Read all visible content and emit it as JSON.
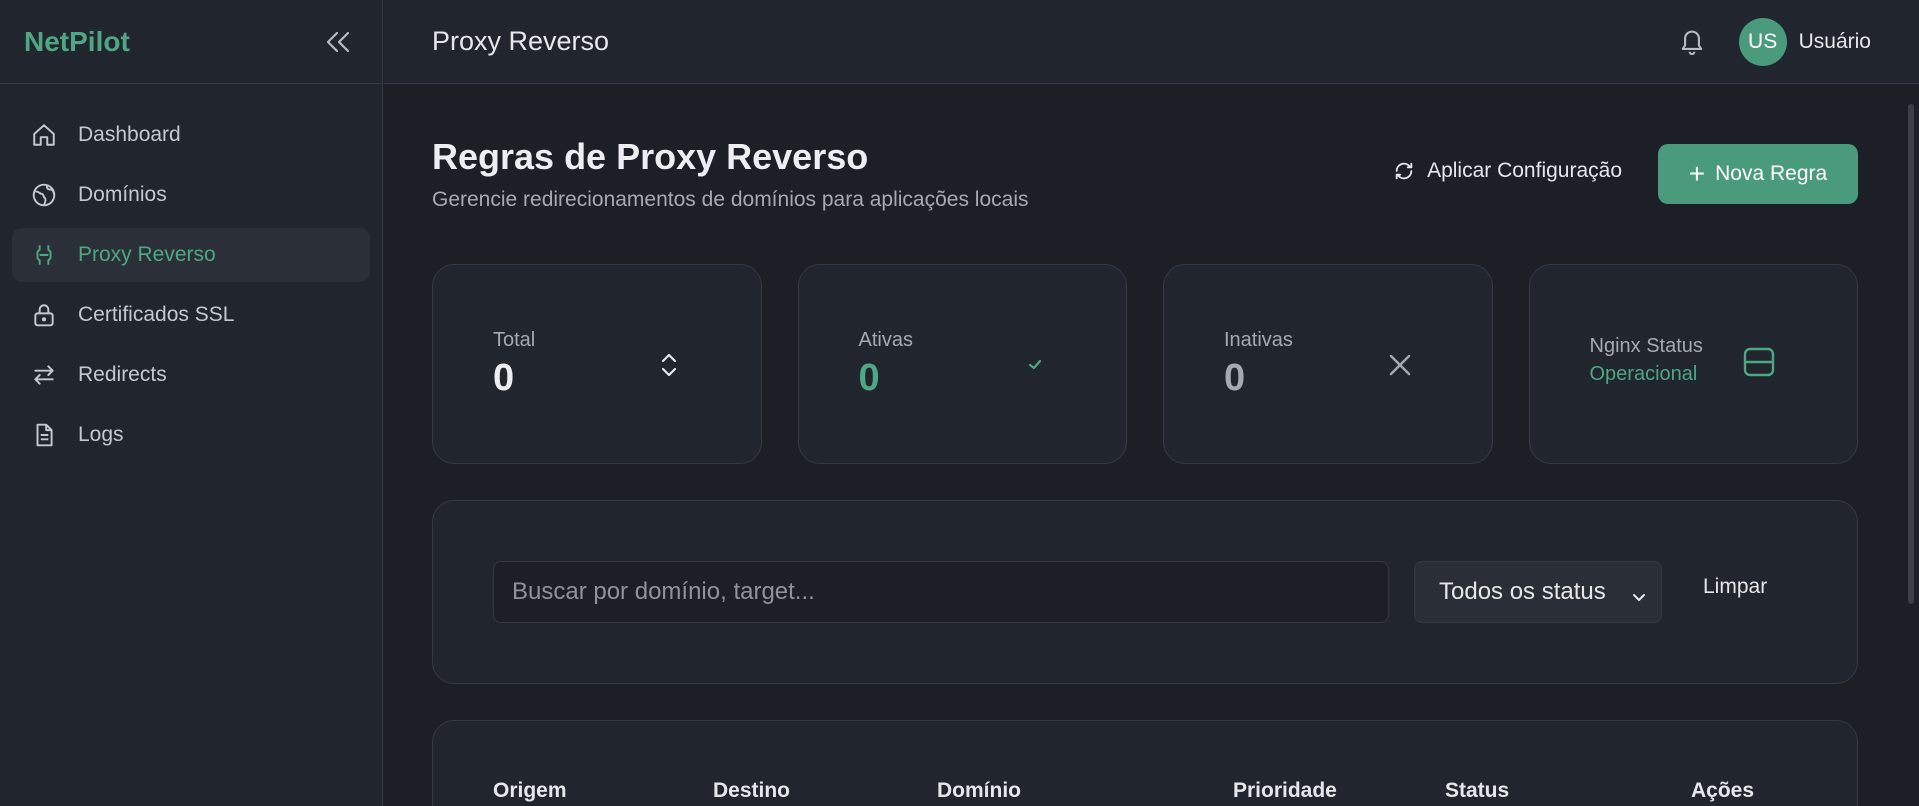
{
  "app": {
    "name": "NetPilot"
  },
  "sidebar": {
    "items": [
      {
        "label": "Dashboard",
        "icon": "home-icon",
        "active": false
      },
      {
        "label": "Domínios",
        "icon": "globe-icon",
        "active": false
      },
      {
        "label": "Proxy Reverso",
        "icon": "proxy-icon",
        "active": true
      },
      {
        "label": "Certificados SSL",
        "icon": "lock-icon",
        "active": false
      },
      {
        "label": "Redirects",
        "icon": "arrows-swap-icon",
        "active": false
      },
      {
        "label": "Logs",
        "icon": "file-icon",
        "active": false
      }
    ]
  },
  "header": {
    "title": "Proxy Reverso",
    "user": {
      "initials": "US",
      "name": "Usuário"
    }
  },
  "page": {
    "title": "Regras de Proxy Reverso",
    "subtitle": "Gerencie redirecionamentos de domínios para aplicações locais",
    "apply_label": "Aplicar Configuração",
    "new_rule_label": "Nova Regra"
  },
  "stats": {
    "total": {
      "label": "Total",
      "value": "0"
    },
    "active": {
      "label": "Ativas",
      "value": "0"
    },
    "inactive": {
      "label": "Inativas",
      "value": "0"
    },
    "nginx": {
      "label": "Nginx Status",
      "value": "Operacional"
    }
  },
  "filters": {
    "search_placeholder": "Buscar por domínio, target...",
    "status_selected": "Todos os status",
    "clear_label": "Limpar"
  },
  "table": {
    "columns": [
      "Origem",
      "Destino",
      "Domínio",
      "Prioridade",
      "Status",
      "Ações"
    ]
  },
  "colors": {
    "accent": "#4fa683",
    "button": "#4a9a7c",
    "background": "#1c1f26",
    "surface": "#21252d"
  }
}
